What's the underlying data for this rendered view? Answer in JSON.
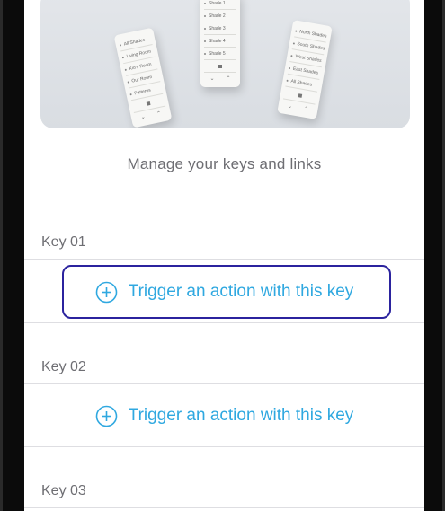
{
  "hero": {
    "remotes": [
      {
        "rows": [
          "All Shades",
          "Living Room",
          "Kid's Room",
          "Our Room",
          "Patterns"
        ]
      },
      {
        "rows": [
          "Shade 1",
          "Shade 2",
          "Shade 3",
          "Shade 4",
          "Shade 5"
        ]
      },
      {
        "rows": [
          "North Shades",
          "South Shades",
          "West Shades",
          "East Shades",
          "All Shades"
        ]
      }
    ]
  },
  "subtitle": "Manage your keys and links",
  "keys": [
    {
      "label": "Key 01",
      "action_label": "Trigger an action with this key",
      "focused": true
    },
    {
      "label": "Key 02",
      "action_label": "Trigger an action with this key",
      "focused": false
    },
    {
      "label": "Key 03"
    }
  ],
  "colors": {
    "accent": "#2fa8e0",
    "focus_ring": "#2b239e",
    "secondary_text": "#6e6e73"
  },
  "icons": {
    "action": "plus-circle-icon"
  }
}
